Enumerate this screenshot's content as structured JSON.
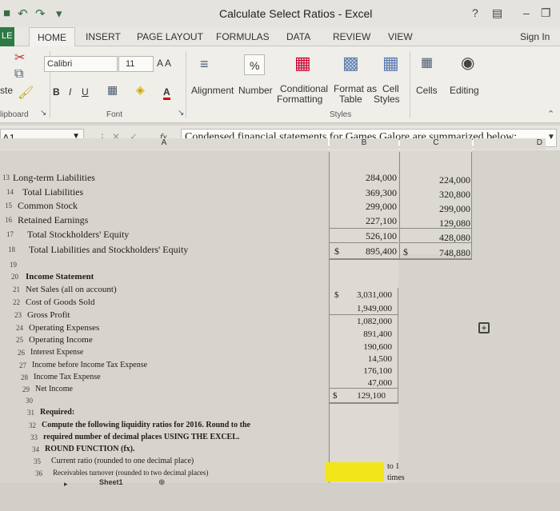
{
  "window": {
    "title": "Calculate Select Ratios - Excel",
    "help": "?",
    "sign_in": "Sign In"
  },
  "tabs": {
    "file": "LE",
    "home": "HOME",
    "insert": "INSERT",
    "page_layout": "PAGE LAYOUT",
    "formulas": "FORMULAS",
    "data": "DATA",
    "review": "REVIEW",
    "view": "VIEW"
  },
  "ribbon": {
    "paste": "ste",
    "clipboard": "lipboard",
    "font_name": "Calibri",
    "font_size": "11",
    "grow_shrink": "A A",
    "bold": "B",
    "italic": "I",
    "underline": "U",
    "font_color": "A",
    "font_group": "Font",
    "alignment": "Alignment",
    "number": "Number",
    "number_icon": "%",
    "conditional": "Conditional",
    "formatting": "Formatting",
    "format_as": "Format as",
    "table": "Table",
    "cell": "Cell",
    "styles": "Styles",
    "styles_group": "Styles",
    "cells": "Cells",
    "editing": "Editing"
  },
  "formula_bar": {
    "cell_ref": "A1",
    "fx": "fx",
    "content": "Condensed financial statements for Games Galore are summarized below:"
  },
  "columns": {
    "a": "A",
    "b": "B",
    "c": "C",
    "d": "D"
  },
  "rows": [
    {
      "n": "13",
      "label": "Long-term Liabilities",
      "b": "284,000",
      "c": "224,000"
    },
    {
      "n": "14",
      "label": "Total Liabilities",
      "b": "369,300",
      "c": "320,800"
    },
    {
      "n": "15",
      "label": "Common Stock",
      "b": "299,000",
      "c": "299,000"
    },
    {
      "n": "16",
      "label": "Retained Earnings",
      "b": "227,100",
      "c": "129,080"
    },
    {
      "n": "17",
      "label": "Total Stockholders' Equity",
      "b": "526,100",
      "c": "428,080"
    },
    {
      "n": "18",
      "label": "Total Liabilities and Stockholders' Equity",
      "b_dollar": "$",
      "b": "895,400",
      "c_dollar": "$",
      "c": "748,880"
    },
    {
      "n": "19",
      "label": ""
    },
    {
      "n": "20",
      "label": "Income Statement"
    },
    {
      "n": "21",
      "label": "Net Sales (all on account)",
      "b_dollar": "$",
      "b": "3,031,000"
    },
    {
      "n": "22",
      "label": "Cost of Goods Sold",
      "b": "1,949,000"
    },
    {
      "n": "23",
      "label": "Gross Profit",
      "b": "1,082,000"
    },
    {
      "n": "24",
      "label": "Operating Expenses",
      "b": "891,400"
    },
    {
      "n": "25",
      "label": "Operating Income",
      "b": "190,600"
    },
    {
      "n": "26",
      "label": "Interest Expense",
      "b": "14,500"
    },
    {
      "n": "27",
      "label": "Income before Income Tax Expense",
      "b": "176,100"
    },
    {
      "n": "28",
      "label": "Income Tax Expense",
      "b": "47,000"
    },
    {
      "n": "29",
      "label": "Net Income",
      "b_dollar": "$",
      "b": "129,100"
    },
    {
      "n": "30",
      "label": ""
    },
    {
      "n": "31",
      "label": "Required:"
    },
    {
      "n": "32",
      "label": "Compute the following liquidity ratios for 2016. Round to the"
    },
    {
      "n": "33",
      "label": "required number of decimal places USING THE EXCEL."
    },
    {
      "n": "34",
      "label": "ROUND FUNCTION (fx)."
    },
    {
      "n": "35",
      "label": "Current ratio (rounded to one decimal place)",
      "suffix": "to 1"
    },
    {
      "n": "36",
      "label": "Receivables turnover (rounded to two decimal places)",
      "suffix": "times"
    }
  ],
  "sheet_tab": "Sheet1"
}
